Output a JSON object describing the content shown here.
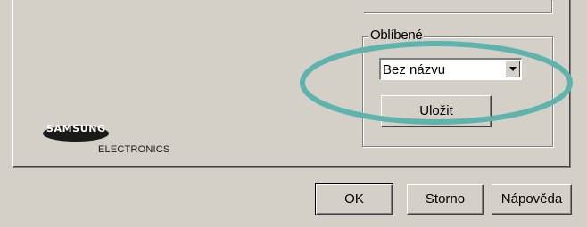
{
  "favorites": {
    "group_label": "Oblíbené",
    "selected_value": "Bez názvu",
    "save_label": "Uložit"
  },
  "logo": {
    "brand": "SAMSUNG",
    "subtitle": "ELECTRONICS"
  },
  "footer": {
    "ok_label": "OK",
    "cancel_label": "Storno",
    "help_label": "Nápověda"
  },
  "colors": {
    "dialog_bg": "#d4d0c8",
    "highlight": "#5fb3ad",
    "logo_brand": "#000000"
  },
  "icons": {
    "dropdown": "chevron-down-icon"
  }
}
